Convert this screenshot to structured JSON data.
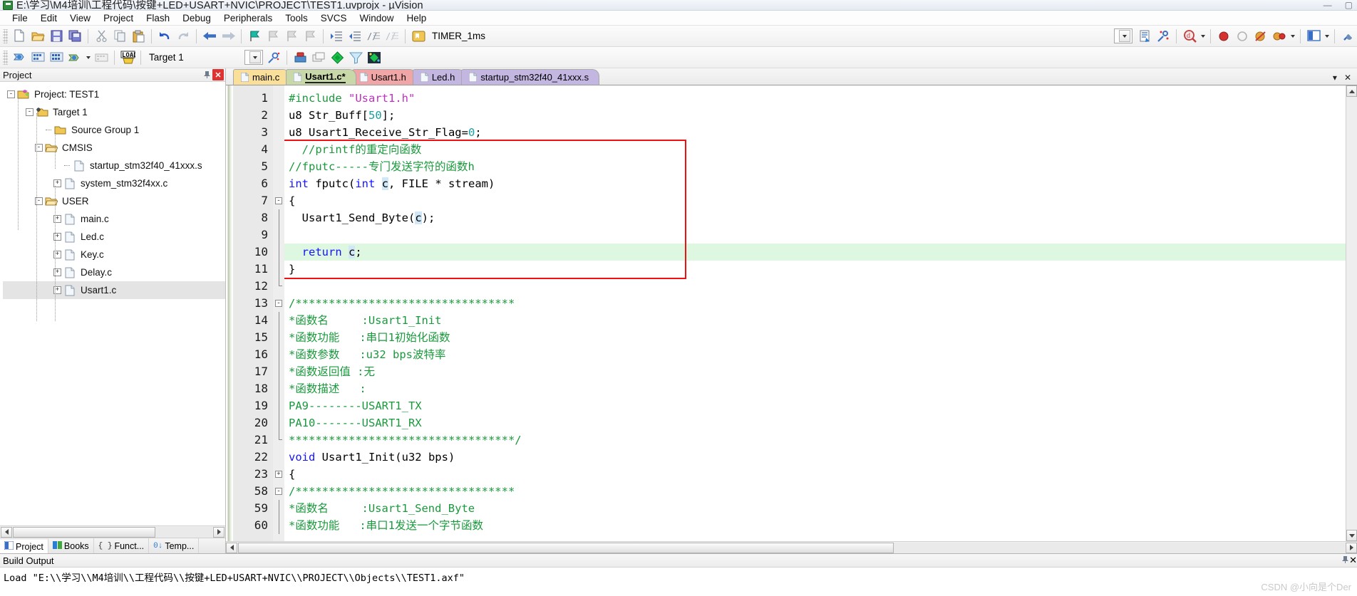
{
  "window": {
    "title": "E:\\学习\\M4培训\\工程代码\\按键+LED+USART+NVIC\\PROJECT\\TEST1.uvprojx - µVision",
    "app_icon": "uvision-icon",
    "minimize": "—",
    "maximize": "▢",
    "close": "✕"
  },
  "menu": {
    "items": [
      {
        "label": "File"
      },
      {
        "label": "Edit"
      },
      {
        "label": "View"
      },
      {
        "label": "Project"
      },
      {
        "label": "Flash"
      },
      {
        "label": "Debug"
      },
      {
        "label": "Peripherals"
      },
      {
        "label": "Tools"
      },
      {
        "label": "SVCS"
      },
      {
        "label": "Window"
      },
      {
        "label": "Help"
      }
    ]
  },
  "toolbar1": {
    "buttons": [
      "new-file-icon",
      "open-file-icon",
      "save-icon",
      "save-all-icon",
      "cut-icon",
      "copy-icon",
      "paste-icon",
      "undo-icon",
      "redo-icon",
      "navigate-back-icon",
      "navigate-forward-icon",
      "bookmark-toggle-icon",
      "bookmark-prev-icon",
      "bookmark-next-icon",
      "bookmark-clear-icon",
      "indent-icon",
      "outdent-icon",
      "comment-icon",
      "uncomment-icon"
    ],
    "bookmark_icon": "bookmark-icon",
    "combo_value": "TIMER_1ms",
    "insert_include_icon": "insert-include-icon",
    "configure_icon": "configure-icon",
    "zoom_icon": "find-icon",
    "breakpoint_icon": "breakpoint-icon",
    "breakpoint_disable_icon": "breakpoint-disable-icon",
    "breakpoint_clear_icon": "breakpoint-clear-icon",
    "breakpoint_all_icon": "breakpoint-all-icon",
    "window_layout_icon": "window-layout-icon",
    "options_icon": "options-icon"
  },
  "toolbar2": {
    "build_icon": "translate-icon",
    "build_target_icon": "build-icon",
    "rebuild_icon": "rebuild-all-icon",
    "batch_build_icon": "batch-build-icon",
    "stop_build_icon": "stop-build-icon",
    "download_icon": "load-icon",
    "target_value": "Target 1",
    "target_options_icon": "target-options-icon",
    "manage_icon": "manage-project-items-icon",
    "multi_project_icon": "multi-project-icon",
    "pack_install_icon": "pack-installer-icon",
    "pack_filter_icon": "pack-filter-icon",
    "pack_manage_icon": "manage-run-time-env-icon"
  },
  "project_panel": {
    "title": "Project",
    "pin_icon": "pin-icon",
    "close_icon": "close-icon",
    "tree": [
      {
        "label": "Project: TEST1",
        "depth": 0,
        "toggle": "-",
        "icon": "project-icon",
        "selected": false
      },
      {
        "label": "Target 1",
        "depth": 1,
        "toggle": "-",
        "icon": "target-icon",
        "selected": false
      },
      {
        "label": "Source Group 1",
        "depth": 2,
        "toggle": "",
        "icon": "folder-icon",
        "selected": false
      },
      {
        "label": "CMSIS",
        "depth": 2,
        "toggle": "-",
        "icon": "folder-open-icon",
        "selected": false
      },
      {
        "label": "startup_stm32f40_41xxx.s",
        "depth": 3,
        "toggle": "",
        "icon": "file-icon",
        "selected": false
      },
      {
        "label": "system_stm32f4xx.c",
        "depth": 3,
        "toggle": "+",
        "icon": "file-icon",
        "selected": false
      },
      {
        "label": "USER",
        "depth": 2,
        "toggle": "-",
        "icon": "folder-open-icon",
        "selected": false
      },
      {
        "label": "main.c",
        "depth": 3,
        "toggle": "+",
        "icon": "file-icon",
        "selected": false
      },
      {
        "label": "Led.c",
        "depth": 3,
        "toggle": "+",
        "icon": "file-icon",
        "selected": false
      },
      {
        "label": "Key.c",
        "depth": 3,
        "toggle": "+",
        "icon": "file-icon",
        "selected": false
      },
      {
        "label": "Delay.c",
        "depth": 3,
        "toggle": "+",
        "icon": "file-icon",
        "selected": false
      },
      {
        "label": "Usart1.c",
        "depth": 3,
        "toggle": "+",
        "icon": "file-icon",
        "selected": true
      }
    ],
    "bottom_tabs": [
      {
        "label": "Project",
        "icon": "project-tab-icon",
        "active": true
      },
      {
        "label": "Books",
        "icon": "books-tab-icon",
        "active": false
      },
      {
        "label": "Funct...",
        "icon": "functions-tab-icon",
        "active": false
      },
      {
        "label": "Temp...",
        "icon": "templates-tab-icon",
        "active": false
      }
    ]
  },
  "editor": {
    "tabs": [
      {
        "label": "main.c",
        "active": false,
        "modified": false,
        "color_key": "t-main"
      },
      {
        "label": "Usart1.c*",
        "active": true,
        "modified": true,
        "color_key": "t-usartc"
      },
      {
        "label": "Usart1.h",
        "active": false,
        "modified": false,
        "color_key": "t-usarth"
      },
      {
        "label": "Led.h",
        "active": false,
        "modified": false,
        "color_key": "t-ledh"
      },
      {
        "label": "startup_stm32f40_41xxx.s",
        "active": false,
        "modified": false,
        "color_key": "t-startup"
      }
    ],
    "tab_dropdown_icon": "chevron-down-icon",
    "tab_close_icon": "close-icon",
    "lines": [
      {
        "n": "1",
        "fold": "",
        "highlight": false,
        "tokens": [
          {
            "t": "#include ",
            "c": "cm"
          },
          {
            "t": "\"Usart1.h\"",
            "c": "str"
          }
        ]
      },
      {
        "n": "2",
        "fold": "",
        "highlight": false,
        "tokens": [
          {
            "t": "u8 Str_Buff[",
            "c": "pl"
          },
          {
            "t": "50",
            "c": "num"
          },
          {
            "t": "];",
            "c": "pl"
          }
        ]
      },
      {
        "n": "3",
        "fold": "",
        "highlight": false,
        "tokens": [
          {
            "t": "u8 Usart1_Receive_Str_Flag=",
            "c": "pl"
          },
          {
            "t": "0",
            "c": "num"
          },
          {
            "t": ";",
            "c": "pl"
          }
        ]
      },
      {
        "n": "4",
        "fold": "",
        "highlight": false,
        "tokens": [
          {
            "t": "  //printf的重定向函数",
            "c": "cm"
          }
        ]
      },
      {
        "n": "5",
        "fold": "",
        "highlight": false,
        "tokens": [
          {
            "t": "//fputc-----专门发送字符的函数h",
            "c": "cm"
          }
        ]
      },
      {
        "n": "6",
        "fold": "",
        "highlight": false,
        "tokens": [
          {
            "t": "int",
            "c": "k"
          },
          {
            "t": " fputc(",
            "c": "pl"
          },
          {
            "t": "int",
            "c": "k"
          },
          {
            "t": " ",
            "c": "pl"
          },
          {
            "t": "c",
            "c": "sel"
          },
          {
            "t": ", FILE * stream)",
            "c": "pl"
          }
        ]
      },
      {
        "n": "7",
        "fold": "-",
        "highlight": false,
        "tokens": [
          {
            "t": "{",
            "c": "pl"
          }
        ]
      },
      {
        "n": "8",
        "fold": "|",
        "highlight": false,
        "tokens": [
          {
            "t": "  Usart1_Send_Byte(",
            "c": "pl"
          },
          {
            "t": "c",
            "c": "sel"
          },
          {
            "t": ");",
            "c": "pl"
          }
        ]
      },
      {
        "n": "9",
        "fold": "|",
        "highlight": false,
        "tokens": [
          {
            "t": "",
            "c": "pl"
          }
        ]
      },
      {
        "n": "10",
        "fold": "|",
        "highlight": true,
        "tokens": [
          {
            "t": "  ",
            "c": "pl"
          },
          {
            "t": "return",
            "c": "k"
          },
          {
            "t": " ",
            "c": "pl"
          },
          {
            "t": "c",
            "c": "sel"
          },
          {
            "t": ";",
            "c": "pl"
          }
        ]
      },
      {
        "n": "11",
        "fold": "|",
        "highlight": false,
        "tokens": [
          {
            "t": "}",
            "c": "pl"
          }
        ]
      },
      {
        "n": "12",
        "fold": "L",
        "highlight": false,
        "tokens": [
          {
            "t": "",
            "c": "pl"
          }
        ]
      },
      {
        "n": "13",
        "fold": "-",
        "highlight": false,
        "tokens": [
          {
            "t": "/*********************************",
            "c": "cm"
          }
        ]
      },
      {
        "n": "14",
        "fold": "|",
        "highlight": false,
        "tokens": [
          {
            "t": "*函数名     :Usart1_Init",
            "c": "cm"
          }
        ]
      },
      {
        "n": "15",
        "fold": "|",
        "highlight": false,
        "tokens": [
          {
            "t": "*函数功能   :串口1初始化函数",
            "c": "cm"
          }
        ]
      },
      {
        "n": "16",
        "fold": "|",
        "highlight": false,
        "tokens": [
          {
            "t": "*函数参数   :u32 bps波特率",
            "c": "cm"
          }
        ]
      },
      {
        "n": "17",
        "fold": "|",
        "highlight": false,
        "tokens": [
          {
            "t": "*函数返回值 :无",
            "c": "cm"
          }
        ]
      },
      {
        "n": "18",
        "fold": "|",
        "highlight": false,
        "tokens": [
          {
            "t": "*函数描述   :",
            "c": "cm"
          }
        ]
      },
      {
        "n": "19",
        "fold": "|",
        "highlight": false,
        "tokens": [
          {
            "t": "PA9--------USART1_TX",
            "c": "cm"
          }
        ]
      },
      {
        "n": "20",
        "fold": "|",
        "highlight": false,
        "tokens": [
          {
            "t": "PA10-------USART1_RX",
            "c": "cm"
          }
        ]
      },
      {
        "n": "21",
        "fold": "L",
        "highlight": false,
        "tokens": [
          {
            "t": "**********************************/",
            "c": "cm"
          }
        ]
      },
      {
        "n": "22",
        "fold": "",
        "highlight": false,
        "tokens": [
          {
            "t": "void",
            "c": "k"
          },
          {
            "t": " Usart1_Init(u32 bps)",
            "c": "pl"
          }
        ]
      },
      {
        "n": "23",
        "fold": "+",
        "highlight": false,
        "tokens": [
          {
            "t": "{",
            "c": "pl"
          }
        ]
      },
      {
        "n": "58",
        "fold": "-",
        "highlight": false,
        "tokens": [
          {
            "t": "/*********************************",
            "c": "cm"
          }
        ]
      },
      {
        "n": "59",
        "fold": "|",
        "highlight": false,
        "tokens": [
          {
            "t": "*函数名     :Usart1_Send_Byte",
            "c": "cm"
          }
        ]
      },
      {
        "n": "60",
        "fold": "|",
        "highlight": false,
        "tokens": [
          {
            "t": "*函数功能   :串口1发送一个字节函数",
            "c": "cm"
          }
        ]
      }
    ],
    "highlight_box": {
      "label": "fputc-redefinition-highlight"
    }
  },
  "build_output": {
    "title": "Build Output",
    "pin_icon": "pin-icon",
    "close_icon": "close-icon",
    "text": "Load \"E:\\\\学习\\\\M4培训\\\\工程代码\\\\按键+LED+USART+NVIC\\\\PROJECT\\\\Objects\\\\TEST1.axf\""
  },
  "watermark": "CSDN @小向是个Der",
  "colors": {
    "comment_green": "#1a9a3c",
    "keyword_blue": "#1414ff",
    "string_magenta": "#c030c0",
    "number_teal": "#1a9fa0",
    "highlight_line": "#ddf7e0",
    "redbox": "#ee1111",
    "selection": "#cfe7f7"
  }
}
